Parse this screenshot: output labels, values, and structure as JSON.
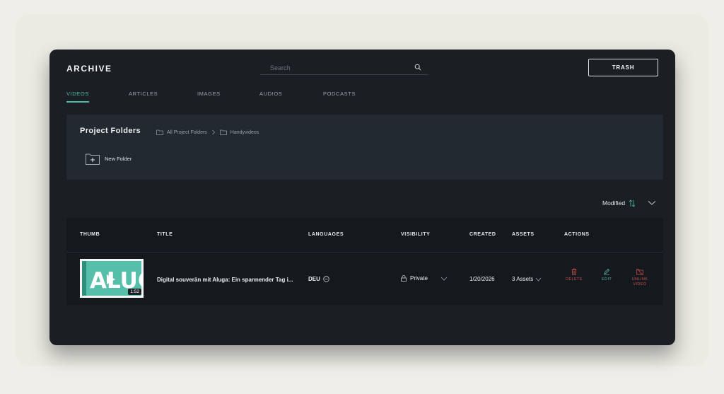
{
  "app": {
    "title": "ARCHIVE"
  },
  "search": {
    "placeholder": "Search"
  },
  "toolbar": {
    "trash_label": "TRASH"
  },
  "tabs": [
    {
      "label": "VIDEOS",
      "active": true
    },
    {
      "label": "ARTICLES",
      "active": false
    },
    {
      "label": "IMAGES",
      "active": false
    },
    {
      "label": "AUDIOS",
      "active": false
    },
    {
      "label": "PODCASTS",
      "active": false
    }
  ],
  "folders": {
    "title": "Project Folders",
    "breadcrumb": [
      "All Project Folders",
      "Handyvideos"
    ],
    "new_folder_label": "New Folder"
  },
  "sort": {
    "label": "Modified"
  },
  "table": {
    "columns": [
      "THUMB",
      "TITLE",
      "LANGUAGES",
      "VISIBILITY",
      "CREATED",
      "ASSETS",
      "ACTIONS"
    ],
    "rows": [
      {
        "thumb_text": "ALUG",
        "duration": "1:52",
        "title": "Digital souverän mit Aluga: Ein spannender Tag i...",
        "language": "DEU",
        "visibility": "Private",
        "created": "1/20/2026",
        "assets": "3 Assets",
        "actions": {
          "delete": "DELETE",
          "edit": "EDIT",
          "unlink": "UNLINK VIDEO"
        }
      }
    ]
  },
  "colors": {
    "accent": "#4fb8a3",
    "danger": "#c4524f",
    "app_bg": "#1b1f24",
    "panel_bg": "#232930",
    "table_bg": "#15191d"
  }
}
